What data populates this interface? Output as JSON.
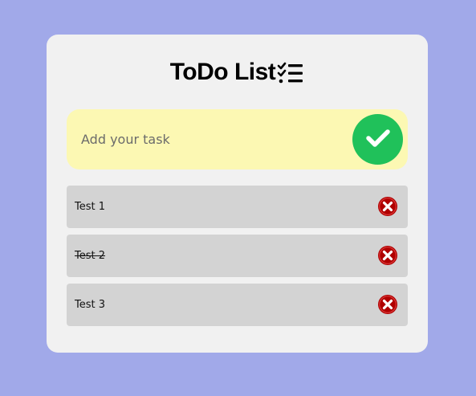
{
  "header": {
    "title": "ToDo List",
    "icon": "checklist-icon"
  },
  "input": {
    "placeholder": "Add your task",
    "value": "",
    "submit_icon": "checkmark-icon"
  },
  "tasks": [
    {
      "label": "Test 1",
      "completed": false,
      "delete_icon": "close-circle-icon"
    },
    {
      "label": "Test 2",
      "completed": true,
      "delete_icon": "close-circle-icon"
    },
    {
      "label": "Test 3",
      "completed": false,
      "delete_icon": "close-circle-icon"
    }
  ],
  "colors": {
    "background": "#a1a9e9",
    "card": "#f1f1f1",
    "input_background": "#fcf8b3",
    "add_button": "#20c15a",
    "item_background": "#d3d3d3",
    "delete_icon": "#b00000"
  }
}
